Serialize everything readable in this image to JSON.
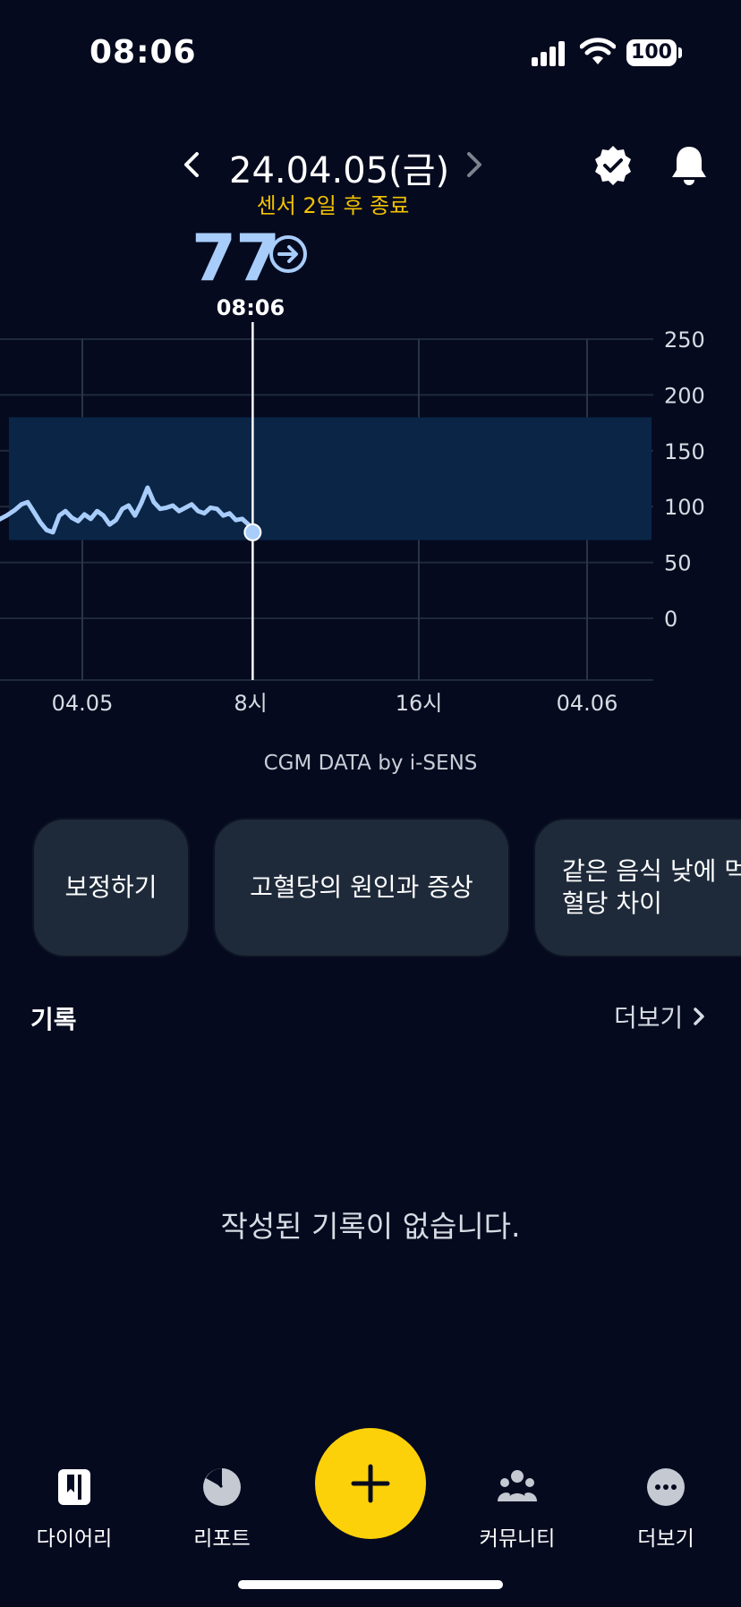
{
  "status_bar": {
    "time": "08:06",
    "battery": "100"
  },
  "header": {
    "date": "24.04.05(금)",
    "sensor_notice": "센서 2일 후 종료"
  },
  "reading": {
    "value": "77",
    "time": "08:06"
  },
  "chart_data": {
    "type": "line",
    "y_ticks": [
      "250",
      "200",
      "150",
      "100",
      "50",
      "0"
    ],
    "x_ticks": [
      "04.05",
      "8시",
      "16시",
      "04.06"
    ],
    "target_range": [
      70,
      180
    ],
    "ylim": [
      0,
      250
    ],
    "series": [
      {
        "x": [
          -4,
          -3.6,
          -3.2,
          -2.9,
          -2.6,
          -2.3,
          -2.0,
          -1.7,
          -1.4,
          -1.1,
          -0.8,
          -0.5,
          -0.2,
          0.1,
          0.4,
          0.7,
          1.0,
          1.3,
          1.6,
          1.9,
          2.2,
          2.5,
          2.8,
          3.1,
          3.4,
          3.7,
          4.0,
          4.3,
          4.6,
          4.9,
          5.2,
          5.5,
          5.8,
          6.1,
          6.4,
          6.7,
          7.0,
          7.3,
          7.6,
          7.9,
          8.1
        ],
        "y": [
          88,
          92,
          97,
          102,
          104,
          95,
          86,
          79,
          77,
          92,
          96,
          90,
          87,
          93,
          89,
          96,
          92,
          84,
          88,
          98,
          101,
          92,
          103,
          117,
          104,
          98,
          99,
          101,
          96,
          99,
          102,
          96,
          94,
          99,
          98,
          92,
          94,
          88,
          89,
          84,
          77
        ]
      }
    ]
  },
  "credit": "CGM DATA by i-SENS",
  "chips": [
    "보정하기",
    "고혈당의 원인과 증상",
    "같은 음식 낮에 먹",
    "혈당 차이"
  ],
  "records": {
    "title": "기록",
    "more": "더보기",
    "empty": "작성된 기록이 없습니다."
  },
  "tabs": {
    "diary": "다이어리",
    "report": "리포트",
    "community": "커뮤니티",
    "more": "더보기"
  },
  "colors": {
    "accent": "#fcd109",
    "reading": "#a9cdfa",
    "sensor": "#f2c200",
    "range": "#0b2546"
  }
}
